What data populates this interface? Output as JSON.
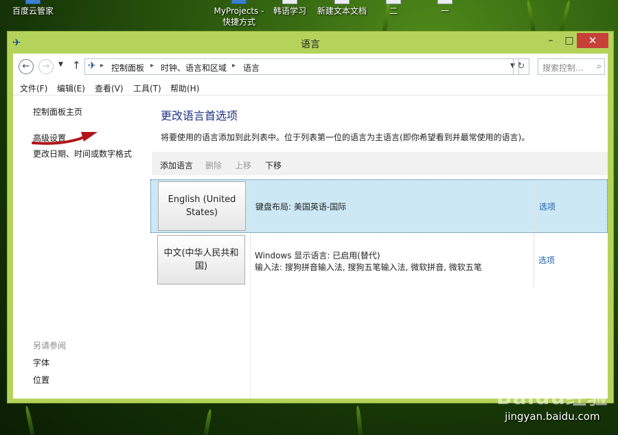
{
  "desktop": {
    "icons": [
      {
        "label": "百度云管家"
      },
      {
        "label": "MyProjects - 快捷方式"
      },
      {
        "label": "韩语学习"
      },
      {
        "label": "新建文本文档"
      },
      {
        "label": "二"
      },
      {
        "label": "一"
      }
    ]
  },
  "window": {
    "title": "语言",
    "controls": {
      "minimize": "–",
      "maximize": "□",
      "close": "✕"
    }
  },
  "address_bar": {
    "breadcrumbs": [
      "控制面板",
      "时钟、语言和区域",
      "语言"
    ],
    "search_placeholder": "搜索控制..."
  },
  "menu": [
    "文件(F)",
    "编辑(E)",
    "查看(V)",
    "工具(T)",
    "帮助(H)"
  ],
  "sidebar": {
    "links": [
      "控制面板主页",
      "高级设置",
      "更改日期、时间或数字格式"
    ],
    "see_also_heading": "另请参阅",
    "see_also": [
      "字体",
      "位置"
    ]
  },
  "main": {
    "heading": "更改语言首选项",
    "description": "将要使用的语言添加到此列表中。位于列表第一位的语言为主语言(即你希望看到并最常使用的语言)。",
    "toolbar": {
      "add": "添加语言",
      "remove": "删除",
      "move_up": "上移",
      "move_down": "下移"
    },
    "languages": [
      {
        "name": "English (United States)",
        "details": [
          "键盘布局: 美国英语-国际"
        ],
        "options": "选项",
        "selected": true
      },
      {
        "name": "中文(中华人民共和国)",
        "details": [
          "Windows 显示语言: 已启用(替代)",
          "输入法: 搜狗拼音输入法, 搜狗五笔输入法, 微软拼音, 微软五笔"
        ],
        "options": "选项",
        "selected": false
      }
    ]
  },
  "watermark": {
    "logo": "Baidu经验",
    "url": "jingyan.baidu.com"
  },
  "colors": {
    "window_frame": "#b5d35b",
    "close_button": "#c7403a",
    "heading": "#1e3287",
    "link": "#1e5db1",
    "selected_row": "#cce8f4",
    "annotation_arrow": "#b0151c"
  }
}
